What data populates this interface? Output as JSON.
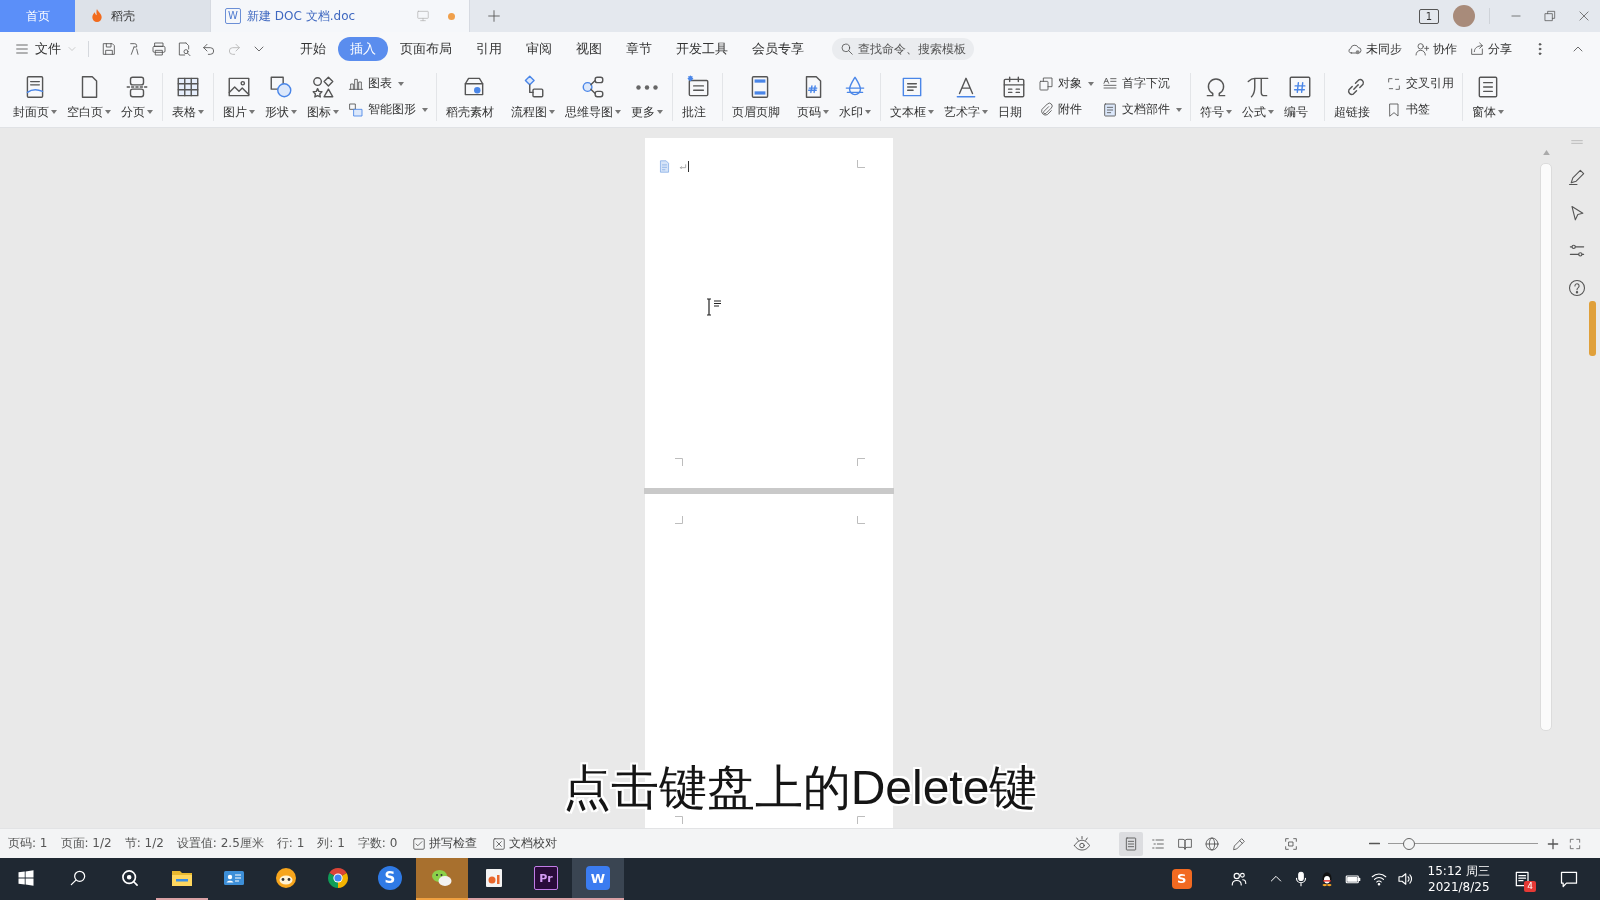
{
  "tab_bar": {
    "tabs": [
      {
        "kind": "home",
        "label": "首页",
        "selected": false
      },
      {
        "kind": "docer",
        "label": "稻壳",
        "selected": false
      },
      {
        "kind": "document",
        "label": "新建 DOC 文档.doc",
        "logo_letter": "W",
        "selected": true,
        "unsaved": true
      }
    ],
    "window_count": "1"
  },
  "menu_bar": {
    "file_menu": "文件",
    "quick_access": [
      {
        "disabled": false
      },
      {
        "disabled": false
      },
      {
        "disabled": false
      },
      {
        "disabled": false
      },
      {
        "disabled": false
      },
      {
        "disabled": true
      },
      {
        "disabled": false
      }
    ],
    "tabs": [
      {
        "label": "开始",
        "selected": false
      },
      {
        "label": "插入",
        "selected": true
      },
      {
        "label": "页面布局",
        "selected": false
      },
      {
        "label": "引用",
        "selected": false
      },
      {
        "label": "审阅",
        "selected": false
      },
      {
        "label": "视图",
        "selected": false
      },
      {
        "label": "章节",
        "selected": false
      },
      {
        "label": "开发工具",
        "selected": false
      },
      {
        "label": "会员专享",
        "selected": false
      }
    ],
    "search": {
      "placeholder": "查找命令、搜索模板"
    },
    "actions": [
      {
        "label": "未同步"
      },
      {
        "label": "协作"
      },
      {
        "label": "分享"
      }
    ]
  },
  "ribbon": {
    "groups": [
      {
        "items": [
          {
            "kind": "large",
            "label": "封面页",
            "dropdown": true
          },
          {
            "kind": "large",
            "label": "空白页",
            "dropdown": true
          },
          {
            "kind": "large",
            "label": "分页",
            "dropdown": true
          }
        ]
      },
      {
        "items": [
          {
            "kind": "large",
            "label": "表格",
            "dropdown": true
          }
        ]
      },
      {
        "items": [
          {
            "kind": "large",
            "label": "图片",
            "dropdown": true
          },
          {
            "kind": "large",
            "label": "形状",
            "dropdown": true
          },
          {
            "kind": "large",
            "label": "图标",
            "dropdown": true
          },
          {
            "kind": "stack",
            "items": [
              {
                "label": "图表",
                "dropdown": true
              },
              {
                "label": "智能图形",
                "dropdown": true
              }
            ]
          }
        ]
      },
      {
        "items": [
          {
            "kind": "large",
            "label": "稻壳素材",
            "dropdown": false
          },
          {
            "kind": "large",
            "label": "流程图",
            "dropdown": true
          },
          {
            "kind": "large",
            "label": "思维导图",
            "dropdown": true
          },
          {
            "kind": "large",
            "label": "更多",
            "dropdown": true
          }
        ]
      },
      {
        "items": [
          {
            "kind": "large",
            "label": "批注",
            "dropdown": false
          }
        ]
      },
      {
        "items": [
          {
            "kind": "large",
            "label": "页眉页脚",
            "dropdown": false
          },
          {
            "kind": "large",
            "label": "页码",
            "dropdown": true
          },
          {
            "kind": "large",
            "label": "水印",
            "dropdown": true
          }
        ]
      },
      {
        "items": [
          {
            "kind": "large",
            "label": "文本框",
            "dropdown": true
          },
          {
            "kind": "large",
            "label": "艺术字",
            "dropdown": true
          },
          {
            "kind": "large",
            "label": "日期",
            "dropdown": false
          },
          {
            "kind": "stack",
            "items": [
              {
                "label": "对象",
                "dropdown": true
              },
              {
                "label": "附件",
                "dropdown": false
              }
            ]
          },
          {
            "kind": "stack",
            "items": [
              {
                "label": "首字下沉",
                "dropdown": false
              },
              {
                "label": "文档部件",
                "dropdown": true
              }
            ]
          }
        ]
      },
      {
        "items": [
          {
            "kind": "large",
            "label": "符号",
            "dropdown": true
          },
          {
            "kind": "large",
            "label": "公式",
            "dropdown": true
          },
          {
            "kind": "large",
            "label": "编号",
            "dropdown": false
          }
        ]
      },
      {
        "items": [
          {
            "kind": "large",
            "label": "超链接",
            "dropdown": false
          },
          {
            "kind": "stack",
            "items": [
              {
                "label": "交叉引用",
                "dropdown": false
              },
              {
                "label": "书签",
                "dropdown": false
              }
            ]
          }
        ]
      },
      {
        "items": [
          {
            "kind": "large",
            "label": "窗体",
            "dropdown": true
          }
        ]
      }
    ]
  },
  "document": {
    "pages": [
      {
        "kind": "content"
      },
      {
        "kind": "blank"
      }
    ]
  },
  "subtitle": "点击键盘上的Delete键",
  "status_bar": {
    "fields": [
      "页码: 1",
      "页面: 1/2",
      "节: 1/2",
      "设置值: 2.5厘米",
      "行: 1",
      "列: 1",
      "字数: 0"
    ],
    "tools": [
      {
        "label": "拼写检查"
      },
      {
        "label": "文档校对"
      }
    ],
    "views": [
      {
        "selected": true
      },
      {
        "selected": false
      },
      {
        "selected": false
      },
      {
        "selected": false
      },
      {
        "selected": false
      }
    ],
    "zoom": {
      "level": 0.14
    }
  },
  "taskbar": {
    "apps": [
      {
        "running": true,
        "selected": false,
        "attention": false
      },
      {
        "running": false,
        "selected": false,
        "attention": false
      },
      {
        "running": false,
        "selected": false,
        "attention": false
      },
      {
        "running": false,
        "selected": false,
        "attention": false
      },
      {
        "logo_letter": "S",
        "running": false,
        "selected": false,
        "attention": false
      },
      {
        "running": true,
        "selected": false,
        "attention": true
      },
      {
        "running": true,
        "selected": false,
        "attention": false
      },
      {
        "logo_letter": "Pr",
        "running": true,
        "selected": false,
        "attention": false
      },
      {
        "logo_letter": "W",
        "running": true,
        "selected": true,
        "attention": false
      }
    ],
    "tray": {
      "ime_letter": "S",
      "time": "15:12 周三",
      "date": "2021/8/25",
      "notification_count": "4"
    }
  }
}
